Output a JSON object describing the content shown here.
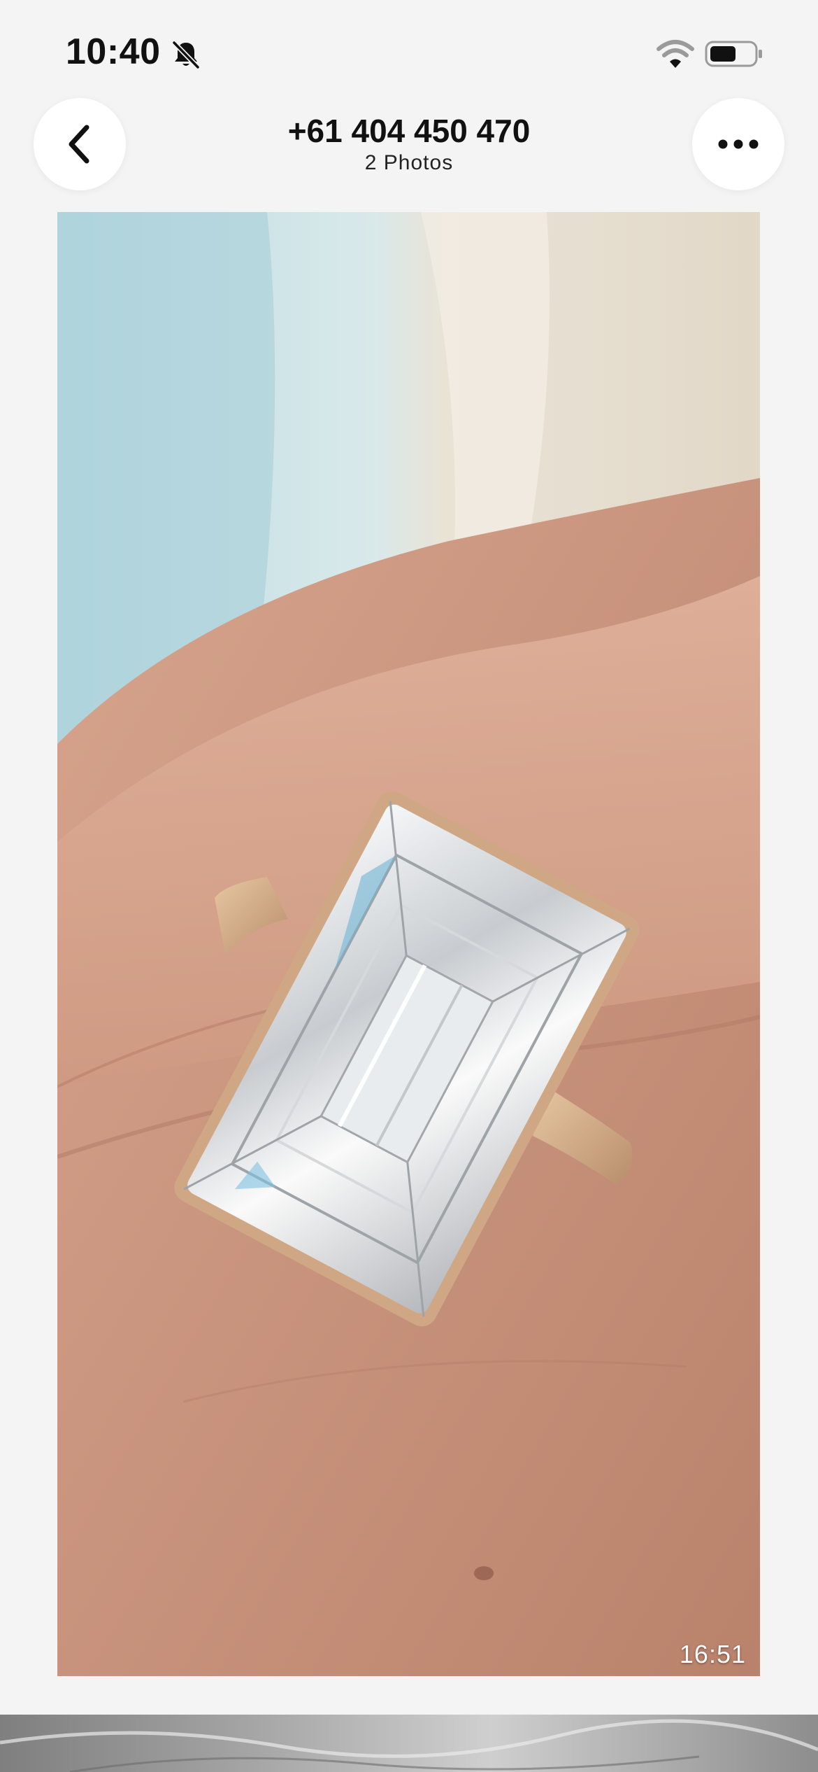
{
  "status_bar": {
    "time": "10:40",
    "icons": [
      "bell-slash-icon",
      "wifi-icon",
      "battery-icon"
    ]
  },
  "header": {
    "title": "+61 404 450 470",
    "subtitle": "2 Photos",
    "back_icon": "chevron-left-icon",
    "more_icon": "ellipsis-icon"
  },
  "photo": {
    "timestamp": "16:51"
  },
  "colors": {
    "background": "#f4f4f4",
    "button_bg": "#ffffff",
    "text": "#111111"
  }
}
